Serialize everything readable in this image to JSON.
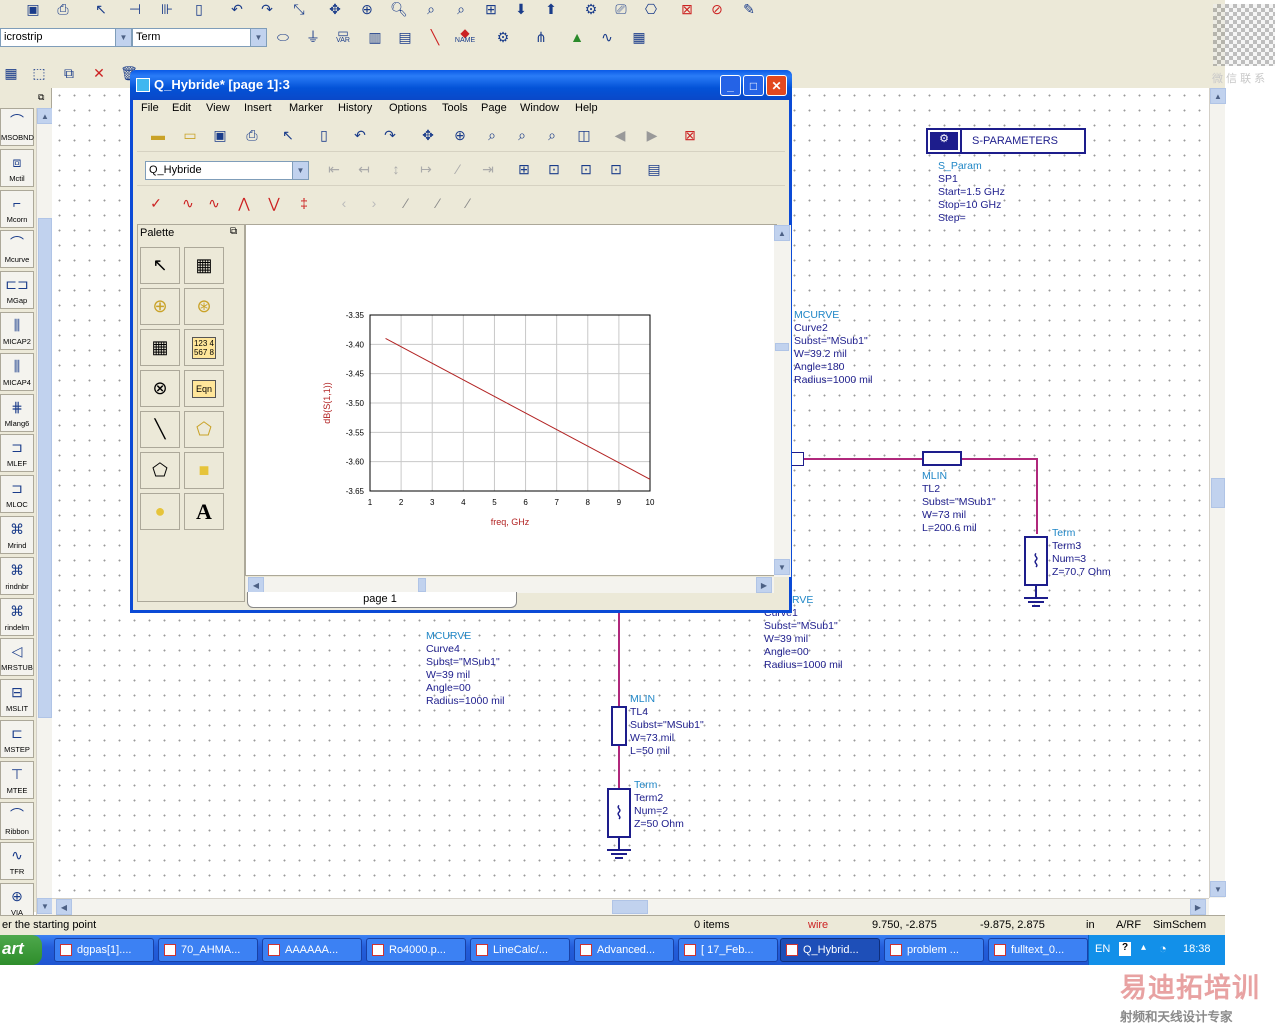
{
  "main_toolbar": {
    "component_library": "icrostrip",
    "component_type": "Term",
    "icon_labels": [
      "VAR",
      "NAME"
    ]
  },
  "left_palette": {
    "items": [
      "MSOBND",
      "Mctil",
      "Mcorn",
      "Mcurve",
      "MGap",
      "MICAP2",
      "MICAP4",
      "Mlang6",
      "MLEF",
      "MLOC",
      "Mrind",
      "rindnbr",
      "rindelm",
      "MRSTUB",
      "MSLIT",
      "MSTEP",
      "MTEE",
      "Ribbon",
      "TFR",
      "VIA"
    ]
  },
  "schematic": {
    "sparam": {
      "box_label": "S-PARAMETERS",
      "lines": [
        "S_Param",
        "SP1",
        "Start=1.5 GHz",
        "Stop=10 GHz",
        "Step="
      ]
    },
    "curve2": [
      "MCURVE",
      "Curve2",
      "Subst=\"MSub1\"",
      "W=39.2 mil",
      "Angle=180",
      "Radius=1000 mil"
    ],
    "tl2": [
      "MLIN",
      "TL2",
      "Subst=\"MSub1\"",
      "W=73 mil",
      "L=200.6 mil"
    ],
    "term3": [
      "Term",
      "Term3",
      "Num=3",
      "Z=70.7 Ohm"
    ],
    "curve1": [
      "RVE",
      "Curve1",
      "Subst=\"MSub1\"",
      "W=39 mil",
      "Angle=00",
      "Radius=1000 mil"
    ],
    "curve4": [
      "MCURVE",
      "Curve4",
      "Subst=\"MSub1\"",
      "W=39 mil",
      "Angle=00",
      "Radius=1000 mil"
    ],
    "tl4": [
      "MLIN",
      "TL4",
      "Subst=\"MSub1\"",
      "W=73 mil",
      "L=50 mil"
    ],
    "term2": [
      "Term",
      "Term2",
      "Num=2",
      "Z=50 Ohm"
    ]
  },
  "dialog": {
    "title": "Q_Hybride* [page 1]:3",
    "menu": [
      "File",
      "Edit",
      "View",
      "Insert",
      "Marker",
      "History",
      "Options",
      "Tools",
      "Page",
      "Window",
      "Help"
    ],
    "dataset": "Q_Hybride",
    "palette_title": "Palette",
    "palette_text": {
      "table_values": "123 4\n567 8",
      "eqn": "Eqn",
      "text_tool": "A"
    },
    "page_tab": "page 1"
  },
  "chart_data": {
    "type": "line",
    "title": "",
    "xlabel": "freq, GHz",
    "ylabel": "dB(S(1,1))",
    "xlim": [
      1,
      10
    ],
    "ylim": [
      -3.65,
      -3.35
    ],
    "x_ticks": [
      "1",
      "2",
      "3",
      "4",
      "5",
      "6",
      "7",
      "8",
      "9",
      "10"
    ],
    "y_ticks": [
      "-3.35",
      "-3.40",
      "-3.45",
      "-3.50",
      "-3.55",
      "-3.60",
      "-3.65"
    ],
    "series": [
      {
        "color": "#b22222",
        "x": [
          1.5,
          10
        ],
        "y": [
          -3.39,
          -3.63
        ]
      }
    ]
  },
  "statusbar": {
    "prompt": "er the starting point",
    "items": "0 items",
    "mode": "wire",
    "coord1": "9.750, -2.875",
    "coord2": "-9.875, 2.875",
    "unit": "in",
    "domain": "A/RF",
    "view": "SimSchem"
  },
  "taskbar": {
    "start": "art",
    "tasks": [
      "dgpas[1]....",
      "70_AHMA...",
      "AAAAAA...",
      "Ro4000.p...",
      "LineCalc/...",
      "Advanced...",
      "[ 17_Feb...",
      "Q_Hybrid...",
      "problem ...",
      "fulltext_0..."
    ],
    "lang": "EN",
    "time": "18:38"
  },
  "watermarks": {
    "qr_caption": "微 信 联 系",
    "brand": "易迪拓培训",
    "brand_sub": "射频和天线设计专家"
  }
}
